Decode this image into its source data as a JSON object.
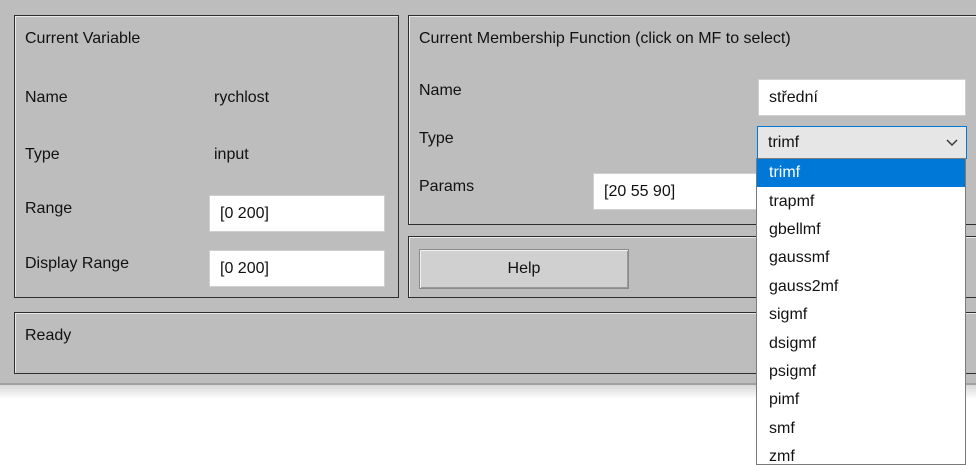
{
  "current_variable": {
    "title": "Current Variable",
    "name_label": "Name",
    "name_value": "rychlost",
    "type_label": "Type",
    "type_value": "input",
    "range_label": "Range",
    "range_value": "[0 200]",
    "display_range_label": "Display Range",
    "display_range_value": "[0 200]"
  },
  "current_mf": {
    "title": "Current Membership Function (click on MF to select)",
    "name_label": "Name",
    "name_value": "střední",
    "type_label": "Type",
    "type_value": "trimf",
    "params_label": "Params",
    "params_value": "[20 55 90]"
  },
  "help_button": {
    "label": "Help"
  },
  "status": {
    "text": "Ready"
  },
  "type_dropdown": {
    "icon": "chevron-down-icon",
    "selected_color": "#0078d7",
    "options": [
      "trimf",
      "trapmf",
      "gbellmf",
      "gaussmf",
      "gauss2mf",
      "sigmf",
      "dsigmf",
      "psigmf",
      "pimf",
      "smf",
      "zmf"
    ]
  }
}
